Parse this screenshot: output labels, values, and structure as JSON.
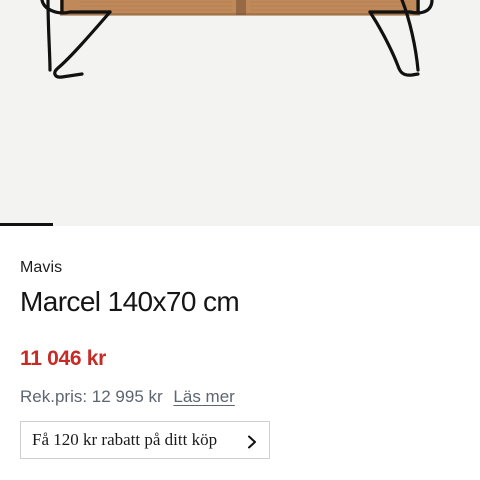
{
  "product": {
    "brand": "Mavis",
    "title": "Marcel 140x70 cm",
    "price": "11 046 kr",
    "rek_label": "Rek.pris: 12 995 kr",
    "read_more_label": "Läs mer",
    "promo_label": "Få 120 kr rabatt på ditt köp"
  },
  "colors": {
    "price": "#c72b26",
    "muted": "#5d6570",
    "hero_background": "#f3f3f1",
    "rattan": "#c0895a",
    "frame": "#111111"
  },
  "icons": {
    "promo_arrow": "chevron-right-icon"
  }
}
